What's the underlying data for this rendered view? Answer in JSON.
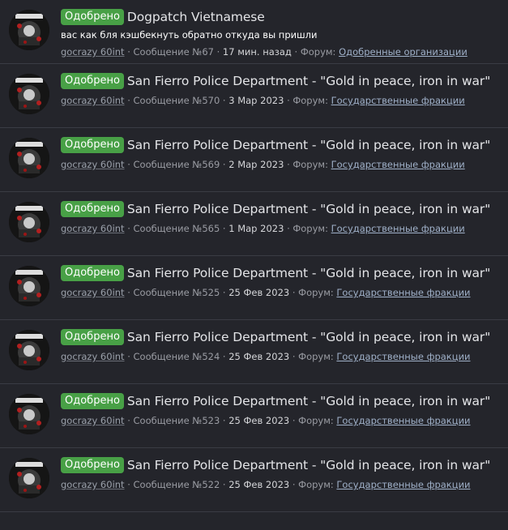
{
  "results": [
    {
      "badge": "Одобрено",
      "title": "Dogpatch Vietnamese",
      "snippet": "вас как бля кэшбекнуть обратно откуда вы пришли",
      "user": "gocrazy 60int",
      "post": "Сообщение №67",
      "date": "17 мин. назад",
      "forum_label": "Форум:",
      "forum": "Одобренные организации"
    },
    {
      "badge": "Одобрено",
      "title": "San Fierro Police Department - \"Gold in peace, iron in war\"",
      "user": "gocrazy 60int",
      "post": "Сообщение №570",
      "date": "3 Мар 2023",
      "forum_label": "Форум:",
      "forum": "Государственные фракции"
    },
    {
      "badge": "Одобрено",
      "title": "San Fierro Police Department - \"Gold in peace, iron in war\"",
      "user": "gocrazy 60int",
      "post": "Сообщение №569",
      "date": "2 Мар 2023",
      "forum_label": "Форум:",
      "forum": "Государственные фракции"
    },
    {
      "badge": "Одобрено",
      "title": "San Fierro Police Department - \"Gold in peace, iron in war\"",
      "user": "gocrazy 60int",
      "post": "Сообщение №565",
      "date": "1 Мар 2023",
      "forum_label": "Форум:",
      "forum": "Государственные фракции"
    },
    {
      "badge": "Одобрено",
      "title": "San Fierro Police Department - \"Gold in peace, iron in war\"",
      "user": "gocrazy 60int",
      "post": "Сообщение №525",
      "date": "25 Фев 2023",
      "forum_label": "Форум:",
      "forum": "Государственные фракции"
    },
    {
      "badge": "Одобрено",
      "title": "San Fierro Police Department - \"Gold in peace, iron in war\"",
      "user": "gocrazy 60int",
      "post": "Сообщение №524",
      "date": "25 Фев 2023",
      "forum_label": "Форум:",
      "forum": "Государственные фракции"
    },
    {
      "badge": "Одобрено",
      "title": "San Fierro Police Department - \"Gold in peace, iron in war\"",
      "user": "gocrazy 60int",
      "post": "Сообщение №523",
      "date": "25 Фев 2023",
      "forum_label": "Форум:",
      "forum": "Государственные фракции"
    },
    {
      "badge": "Одобрено",
      "title": "San Fierro Police Department - \"Gold in peace, iron in war\"",
      "user": "gocrazy 60int",
      "post": "Сообщение №522",
      "date": "25 Фев 2023",
      "forum_label": "Форум:",
      "forum": "Государственные фракции"
    }
  ],
  "colors": {
    "background": "#24252b",
    "badge": "#48a046",
    "divider": "#3a3c44"
  },
  "icons": {
    "avatar": "user-avatar-image"
  }
}
